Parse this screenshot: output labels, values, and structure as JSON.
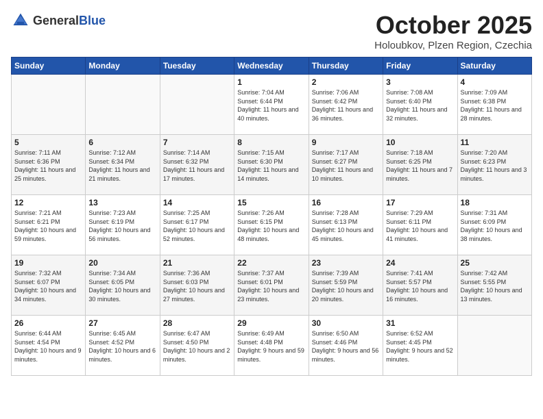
{
  "header": {
    "logo_general": "General",
    "logo_blue": "Blue",
    "month": "October 2025",
    "location": "Holoubkov, Plzen Region, Czechia"
  },
  "weekdays": [
    "Sunday",
    "Monday",
    "Tuesday",
    "Wednesday",
    "Thursday",
    "Friday",
    "Saturday"
  ],
  "weeks": [
    [
      {
        "day": "",
        "info": ""
      },
      {
        "day": "",
        "info": ""
      },
      {
        "day": "",
        "info": ""
      },
      {
        "day": "1",
        "info": "Sunrise: 7:04 AM\nSunset: 6:44 PM\nDaylight: 11 hours\nand 40 minutes."
      },
      {
        "day": "2",
        "info": "Sunrise: 7:06 AM\nSunset: 6:42 PM\nDaylight: 11 hours\nand 36 minutes."
      },
      {
        "day": "3",
        "info": "Sunrise: 7:08 AM\nSunset: 6:40 PM\nDaylight: 11 hours\nand 32 minutes."
      },
      {
        "day": "4",
        "info": "Sunrise: 7:09 AM\nSunset: 6:38 PM\nDaylight: 11 hours\nand 28 minutes."
      }
    ],
    [
      {
        "day": "5",
        "info": "Sunrise: 7:11 AM\nSunset: 6:36 PM\nDaylight: 11 hours\nand 25 minutes."
      },
      {
        "day": "6",
        "info": "Sunrise: 7:12 AM\nSunset: 6:34 PM\nDaylight: 11 hours\nand 21 minutes."
      },
      {
        "day": "7",
        "info": "Sunrise: 7:14 AM\nSunset: 6:32 PM\nDaylight: 11 hours\nand 17 minutes."
      },
      {
        "day": "8",
        "info": "Sunrise: 7:15 AM\nSunset: 6:30 PM\nDaylight: 11 hours\nand 14 minutes."
      },
      {
        "day": "9",
        "info": "Sunrise: 7:17 AM\nSunset: 6:27 PM\nDaylight: 11 hours\nand 10 minutes."
      },
      {
        "day": "10",
        "info": "Sunrise: 7:18 AM\nSunset: 6:25 PM\nDaylight: 11 hours\nand 7 minutes."
      },
      {
        "day": "11",
        "info": "Sunrise: 7:20 AM\nSunset: 6:23 PM\nDaylight: 11 hours\nand 3 minutes."
      }
    ],
    [
      {
        "day": "12",
        "info": "Sunrise: 7:21 AM\nSunset: 6:21 PM\nDaylight: 10 hours\nand 59 minutes."
      },
      {
        "day": "13",
        "info": "Sunrise: 7:23 AM\nSunset: 6:19 PM\nDaylight: 10 hours\nand 56 minutes."
      },
      {
        "day": "14",
        "info": "Sunrise: 7:25 AM\nSunset: 6:17 PM\nDaylight: 10 hours\nand 52 minutes."
      },
      {
        "day": "15",
        "info": "Sunrise: 7:26 AM\nSunset: 6:15 PM\nDaylight: 10 hours\nand 48 minutes."
      },
      {
        "day": "16",
        "info": "Sunrise: 7:28 AM\nSunset: 6:13 PM\nDaylight: 10 hours\nand 45 minutes."
      },
      {
        "day": "17",
        "info": "Sunrise: 7:29 AM\nSunset: 6:11 PM\nDaylight: 10 hours\nand 41 minutes."
      },
      {
        "day": "18",
        "info": "Sunrise: 7:31 AM\nSunset: 6:09 PM\nDaylight: 10 hours\nand 38 minutes."
      }
    ],
    [
      {
        "day": "19",
        "info": "Sunrise: 7:32 AM\nSunset: 6:07 PM\nDaylight: 10 hours\nand 34 minutes."
      },
      {
        "day": "20",
        "info": "Sunrise: 7:34 AM\nSunset: 6:05 PM\nDaylight: 10 hours\nand 30 minutes."
      },
      {
        "day": "21",
        "info": "Sunrise: 7:36 AM\nSunset: 6:03 PM\nDaylight: 10 hours\nand 27 minutes."
      },
      {
        "day": "22",
        "info": "Sunrise: 7:37 AM\nSunset: 6:01 PM\nDaylight: 10 hours\nand 23 minutes."
      },
      {
        "day": "23",
        "info": "Sunrise: 7:39 AM\nSunset: 5:59 PM\nDaylight: 10 hours\nand 20 minutes."
      },
      {
        "day": "24",
        "info": "Sunrise: 7:41 AM\nSunset: 5:57 PM\nDaylight: 10 hours\nand 16 minutes."
      },
      {
        "day": "25",
        "info": "Sunrise: 7:42 AM\nSunset: 5:55 PM\nDaylight: 10 hours\nand 13 minutes."
      }
    ],
    [
      {
        "day": "26",
        "info": "Sunrise: 6:44 AM\nSunset: 4:54 PM\nDaylight: 10 hours\nand 9 minutes."
      },
      {
        "day": "27",
        "info": "Sunrise: 6:45 AM\nSunset: 4:52 PM\nDaylight: 10 hours\nand 6 minutes."
      },
      {
        "day": "28",
        "info": "Sunrise: 6:47 AM\nSunset: 4:50 PM\nDaylight: 10 hours\nand 2 minutes."
      },
      {
        "day": "29",
        "info": "Sunrise: 6:49 AM\nSunset: 4:48 PM\nDaylight: 9 hours\nand 59 minutes."
      },
      {
        "day": "30",
        "info": "Sunrise: 6:50 AM\nSunset: 4:46 PM\nDaylight: 9 hours\nand 56 minutes."
      },
      {
        "day": "31",
        "info": "Sunrise: 6:52 AM\nSunset: 4:45 PM\nDaylight: 9 hours\nand 52 minutes."
      },
      {
        "day": "",
        "info": ""
      }
    ]
  ]
}
